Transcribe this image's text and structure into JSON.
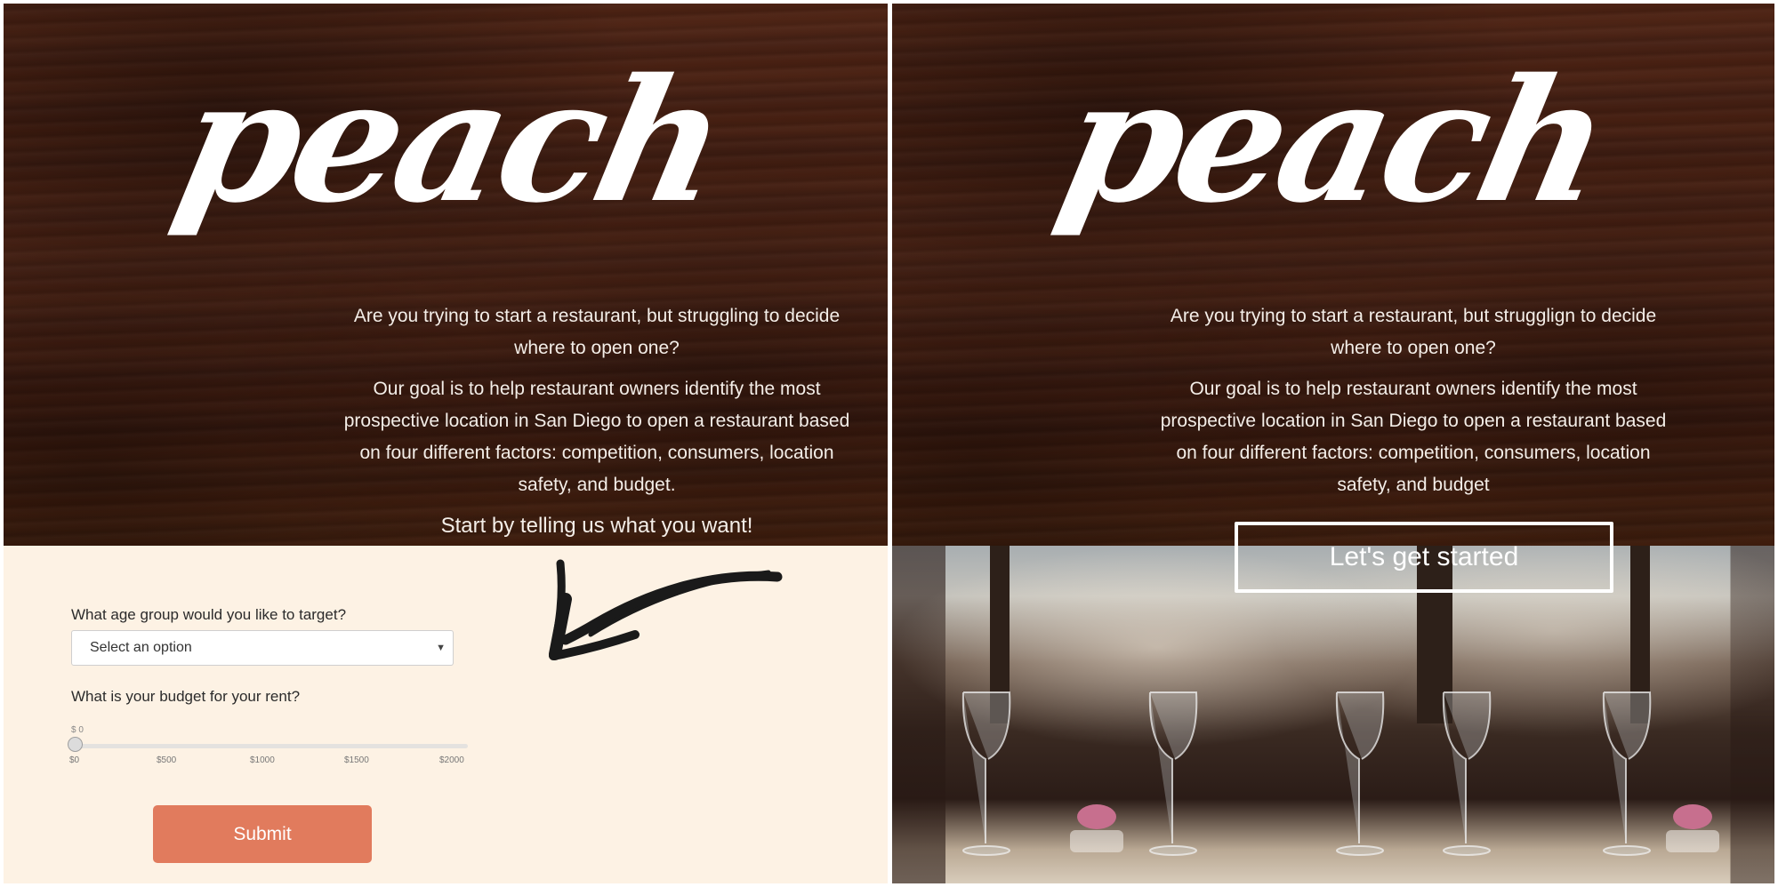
{
  "left": {
    "logo": "peach",
    "intro": "Are you trying to start a restaurant, but struggling to decide where to open one?",
    "goal": "Our goal is to help restaurant owners identify the most prospective location in San Diego to open a restaurant based on four different factors: competition, consumers, location safety, and budget.",
    "tagline": "Start by telling us what you want!",
    "form": {
      "age_question": "What age group would you like to target?",
      "age_select_value": "Select an option",
      "budget_question": "What is your budget for your rent?",
      "slider_value_label": "$ 0",
      "slider_value": 0,
      "slider_ticks": [
        "$0",
        "$500",
        "$1000",
        "$1500",
        "$2000"
      ],
      "submit_label": "Submit"
    }
  },
  "right": {
    "logo": "peach",
    "intro": "Are you trying to start a restaurant, but strugglign to decide where to open one?",
    "goal": "Our goal is to help restaurant owners identify the most prospective location in San Diego to open a restaurant based on four different factors: competition, consumers, location safety, and budget",
    "cta_label": "Let's get started"
  },
  "colors": {
    "wood": "#42200f",
    "form_bg": "#fdf2e4",
    "submit": "#e17b5d",
    "text_light": "#ffffff"
  },
  "icons": [
    "select-caret-icon",
    "hand-drawn-arrow-icon"
  ]
}
